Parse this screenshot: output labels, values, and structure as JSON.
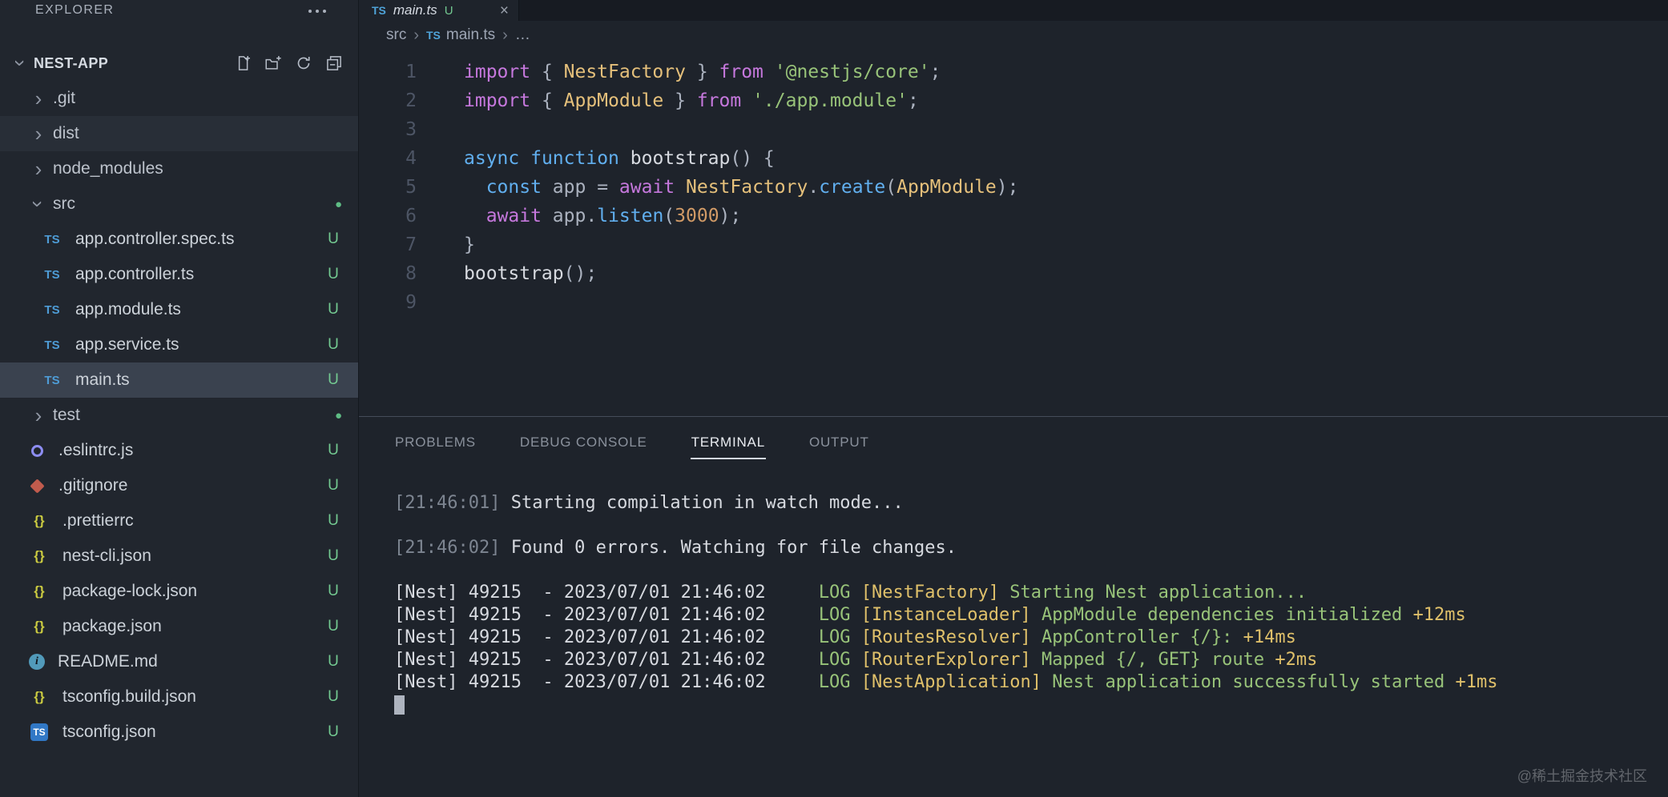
{
  "colors": {
    "untracked_badge": "#73c991",
    "modified_dot": "#5fbd85",
    "keyword_purple": "#c678dd",
    "keyword_blue": "#61afef",
    "class_yellow": "#e5c07b",
    "string_green": "#98c379",
    "number_orange": "#d19a66",
    "terminal_green": "#98c379",
    "terminal_yellow": "#dfc06a",
    "ts_icon_blue": "#4e9cd6"
  },
  "icon_glyphs": {
    "ts": "TS",
    "tsconfig": "TS",
    "json": "{}",
    "info": "i",
    "eslint": "",
    "git": "",
    "chevron": "›",
    "separator": "›",
    "dot": "●",
    "close": "×"
  },
  "sidebar": {
    "title": "EXPLORER",
    "workspace": "NEST-APP",
    "actions": [
      "new-file",
      "new-folder",
      "refresh-explorer",
      "collapse-folders"
    ],
    "tree": [
      {
        "kind": "folder",
        "label": ".git",
        "level": 1
      },
      {
        "kind": "folder",
        "label": "dist",
        "level": 1,
        "state": "hover"
      },
      {
        "kind": "folder",
        "label": "node_modules",
        "level": 1
      },
      {
        "kind": "folder",
        "label": "src",
        "level": 1,
        "expanded": true,
        "dot": true
      },
      {
        "kind": "file",
        "icon": "ts",
        "label": "app.controller.spec.ts",
        "badge": "U",
        "level": 2
      },
      {
        "kind": "file",
        "icon": "ts",
        "label": "app.controller.ts",
        "badge": "U",
        "level": 2
      },
      {
        "kind": "file",
        "icon": "ts",
        "label": "app.module.ts",
        "badge": "U",
        "level": 2
      },
      {
        "kind": "file",
        "icon": "ts",
        "label": "app.service.ts",
        "badge": "U",
        "level": 2
      },
      {
        "kind": "file",
        "icon": "ts",
        "label": "main.ts",
        "badge": "U",
        "level": 2,
        "state": "selected"
      },
      {
        "kind": "folder",
        "label": "test",
        "level": 1,
        "dot": true
      },
      {
        "kind": "file",
        "icon": "eslint",
        "label": ".eslintrc.js",
        "badge": "U",
        "level": 1
      },
      {
        "kind": "file",
        "icon": "git",
        "label": ".gitignore",
        "badge": "U",
        "level": 1
      },
      {
        "kind": "file",
        "icon": "json",
        "label": ".prettierrc",
        "badge": "U",
        "level": 1
      },
      {
        "kind": "file",
        "icon": "json",
        "label": "nest-cli.json",
        "badge": "U",
        "level": 1
      },
      {
        "kind": "file",
        "icon": "json",
        "label": "package-lock.json",
        "badge": "U",
        "level": 1
      },
      {
        "kind": "file",
        "icon": "json",
        "label": "package.json",
        "badge": "U",
        "level": 1
      },
      {
        "kind": "file",
        "icon": "info",
        "label": "README.md",
        "badge": "U",
        "level": 1
      },
      {
        "kind": "file",
        "icon": "json",
        "label": "tsconfig.build.json",
        "badge": "U",
        "level": 1
      },
      {
        "kind": "file",
        "icon": "tsconfig",
        "label": "tsconfig.json",
        "badge": "U",
        "level": 1
      }
    ]
  },
  "editor": {
    "tab": {
      "label": "main.ts",
      "git_badge": "U"
    },
    "breadcrumbs": {
      "segments": [
        "src",
        "main.ts"
      ],
      "trailing": "…"
    },
    "code_lines": [
      {
        "n": "1",
        "t": [
          [
            "kw",
            "import"
          ],
          [
            "pl",
            " { "
          ],
          [
            "cl",
            "NestFactory"
          ],
          [
            "pl",
            " } "
          ],
          [
            "kw",
            "from"
          ],
          [
            "pl",
            " "
          ],
          [
            "st",
            "'@nestjs/core'"
          ],
          [
            "pl",
            ";"
          ]
        ]
      },
      {
        "n": "2",
        "t": [
          [
            "kw",
            "import"
          ],
          [
            "pl",
            " { "
          ],
          [
            "cl",
            "AppModule"
          ],
          [
            "pl",
            " } "
          ],
          [
            "kw",
            "from"
          ],
          [
            "pl",
            " "
          ],
          [
            "st",
            "'./app.module'"
          ],
          [
            "pl",
            ";"
          ]
        ]
      },
      {
        "n": "3",
        "t": []
      },
      {
        "n": "4",
        "t": [
          [
            "bl",
            "async"
          ],
          [
            "pl",
            " "
          ],
          [
            "bl",
            "function"
          ],
          [
            "pl",
            " "
          ],
          [
            "fn",
            "bootstrap"
          ],
          [
            "pl",
            "() {"
          ]
        ]
      },
      {
        "n": "5",
        "t": [
          [
            "pl",
            "  "
          ],
          [
            "bl",
            "const"
          ],
          [
            "pl",
            " app = "
          ],
          [
            "kw",
            "await"
          ],
          [
            "pl",
            " "
          ],
          [
            "cl",
            "NestFactory"
          ],
          [
            "pl",
            "."
          ],
          [
            "bl",
            "create"
          ],
          [
            "pl",
            "("
          ],
          [
            "cl",
            "AppModule"
          ],
          [
            "pl",
            ");"
          ]
        ]
      },
      {
        "n": "6",
        "t": [
          [
            "pl",
            "  "
          ],
          [
            "kw",
            "await"
          ],
          [
            "pl",
            " app."
          ],
          [
            "bl",
            "listen"
          ],
          [
            "pl",
            "("
          ],
          [
            "nu",
            "3000"
          ],
          [
            "pl",
            ");"
          ]
        ]
      },
      {
        "n": "7",
        "t": [
          [
            "pl",
            "}"
          ]
        ]
      },
      {
        "n": "8",
        "t": [
          [
            "fn",
            "bootstrap"
          ],
          [
            "pl",
            "();"
          ]
        ]
      },
      {
        "n": "9",
        "t": []
      }
    ]
  },
  "panel": {
    "tabs": [
      {
        "label": "PROBLEMS",
        "active": false
      },
      {
        "label": "DEBUG CONSOLE",
        "active": false
      },
      {
        "label": "TERMINAL",
        "active": true
      },
      {
        "label": "OUTPUT",
        "active": false
      }
    ],
    "terminal_lines": [
      {
        "s": [
          [
            "gy",
            "[21:46:01] "
          ],
          [
            "wh",
            "Starting compilation in watch mode..."
          ]
        ]
      },
      {
        "s": []
      },
      {
        "s": [
          [
            "gy",
            "[21:46:02] "
          ],
          [
            "wh",
            "Found 0 errors. Watching for file changes."
          ]
        ]
      },
      {
        "s": []
      },
      {
        "s": [
          [
            "wh",
            "[Nest] 49215  - 2023/07/01 21:46:02     "
          ],
          [
            "gn",
            "LOG "
          ],
          [
            "yl",
            "[NestFactory] "
          ],
          [
            "gn",
            "Starting Nest application..."
          ]
        ]
      },
      {
        "s": [
          [
            "wh",
            "[Nest] 49215  - 2023/07/01 21:46:02     "
          ],
          [
            "gn",
            "LOG "
          ],
          [
            "yl",
            "[InstanceLoader] "
          ],
          [
            "gn",
            "AppModule dependencies initialized "
          ],
          [
            "yl",
            "+12ms"
          ]
        ]
      },
      {
        "s": [
          [
            "wh",
            "[Nest] 49215  - 2023/07/01 21:46:02     "
          ],
          [
            "gn",
            "LOG "
          ],
          [
            "yl",
            "[RoutesResolver] "
          ],
          [
            "gn",
            "AppController {/}: "
          ],
          [
            "yl",
            "+14ms"
          ]
        ]
      },
      {
        "s": [
          [
            "wh",
            "[Nest] 49215  - 2023/07/01 21:46:02     "
          ],
          [
            "gn",
            "LOG "
          ],
          [
            "yl",
            "[RouterExplorer] "
          ],
          [
            "gn",
            "Mapped {/, GET} route "
          ],
          [
            "yl",
            "+2ms"
          ]
        ]
      },
      {
        "s": [
          [
            "wh",
            "[Nest] 49215  - 2023/07/01 21:46:02     "
          ],
          [
            "gn",
            "LOG "
          ],
          [
            "yl",
            "[NestApplication] "
          ],
          [
            "gn",
            "Nest application successfully started "
          ],
          [
            "yl",
            "+1ms"
          ]
        ]
      },
      {
        "s": [],
        "cursor": true
      }
    ]
  },
  "watermark": "@稀土掘金技术社区"
}
